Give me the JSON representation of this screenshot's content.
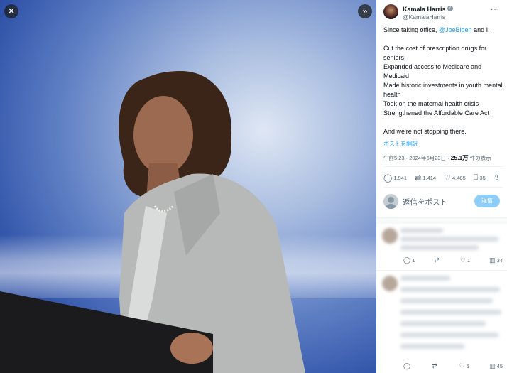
{
  "media": {
    "close_icon": "close-icon",
    "expand_icon": "collapse-panel-icon",
    "close_glyph": "✕",
    "expand_glyph": "»"
  },
  "author": {
    "name": "Kamala Harris",
    "handle": "@KamalaHarris",
    "verified_icon": "verified-badge-icon"
  },
  "tweet": {
    "intro_prefix": "Since taking office, ",
    "mention": "@JoeBiden",
    "intro_suffix": " and I:",
    "lines": [
      "Cut the cost of prescription drugs for seniors",
      "Expanded access to Medicare and Medicaid",
      "Made historic investments in youth mental health",
      "Took on the maternal health crisis",
      "Strengthened the Affordable Care Act"
    ],
    "closing": "And we're not stopping there.",
    "translate": "ポストを翻訳"
  },
  "meta": {
    "time": "午前5:23 · 2024年5月23日 · ",
    "views": "25.1万",
    "views_suffix": " 件の表示"
  },
  "actions": {
    "replies": "1,941",
    "reposts": "1,414",
    "likes": "4,485",
    "bookmarks": "35"
  },
  "reply_box": {
    "placeholder": "返信をポスト",
    "button": "返信"
  },
  "replies": [
    {
      "replies": "1",
      "reposts": "",
      "likes": "1",
      "views": "34"
    },
    {
      "replies": "",
      "reposts": "",
      "likes": "5",
      "views": "45"
    }
  ],
  "colors": {
    "accent": "#1d9bf0",
    "reply_button": "#8ecdf7",
    "text": "#0f1419",
    "muted": "#536471"
  }
}
